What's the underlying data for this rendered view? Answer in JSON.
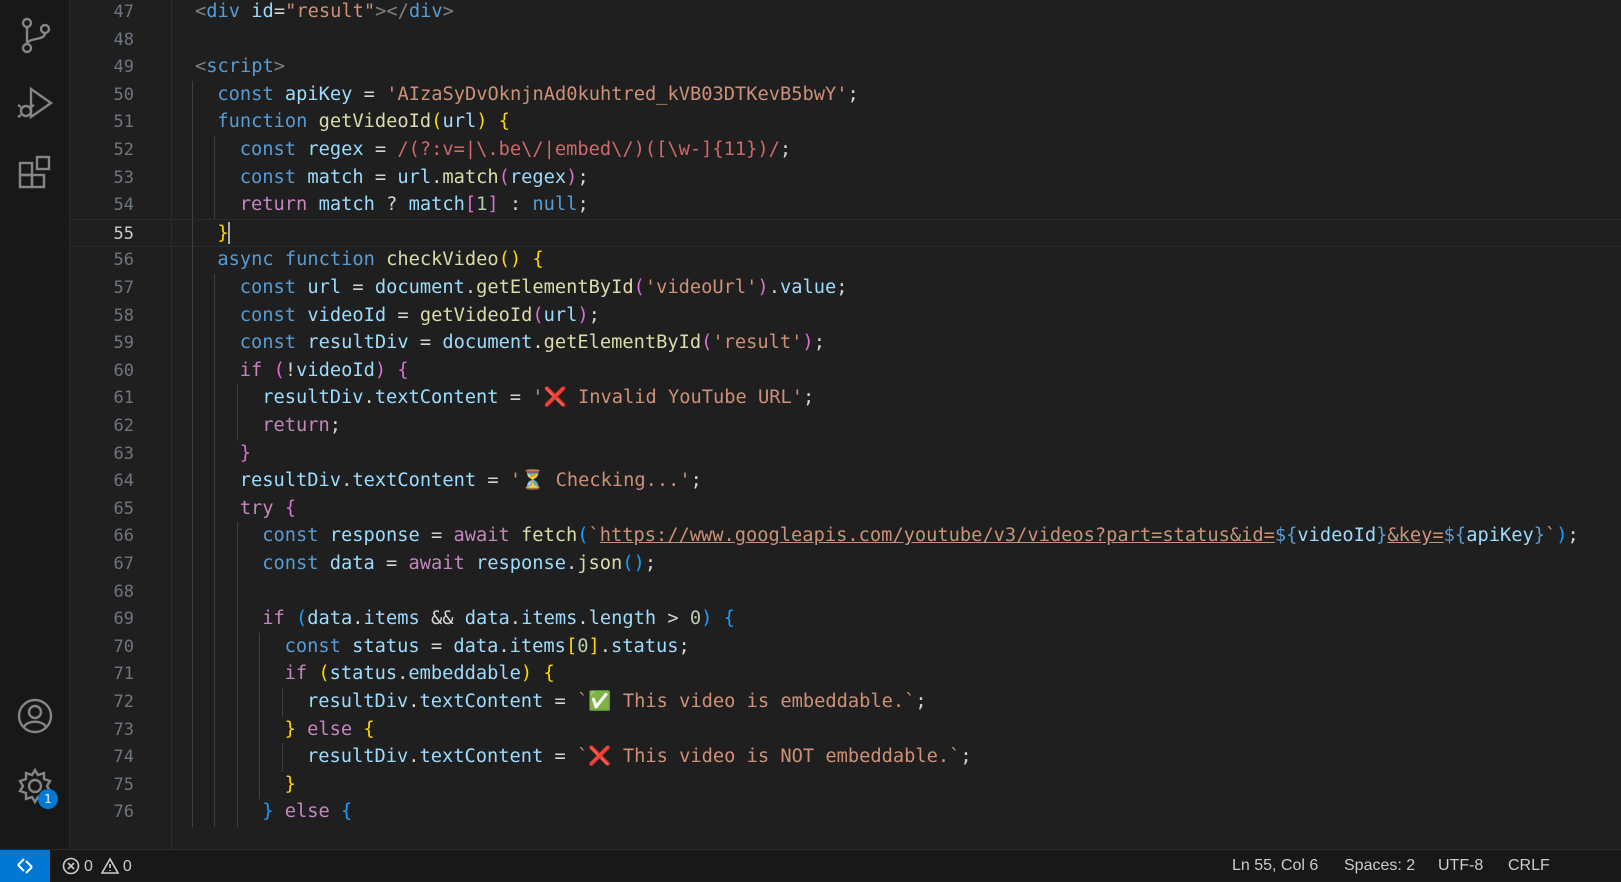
{
  "activity_bar": {
    "top_icons": [
      "source-control-icon",
      "run-debug-icon",
      "extensions-icon"
    ],
    "bottom_icons": [
      "account-icon",
      "manage-gear-icon"
    ],
    "settings_badge": "1"
  },
  "editor": {
    "current_line": 55,
    "lines": [
      {
        "n": "47",
        "tokens": [
          [
            "t-tag",
            "<"
          ],
          [
            "t-tn",
            "div"
          ],
          [
            "t-op",
            " "
          ],
          [
            "t-attr",
            "id"
          ],
          [
            "t-op",
            "="
          ],
          [
            "t-str",
            "\"result\""
          ],
          [
            "t-tag",
            "></"
          ],
          [
            "t-tn",
            "div"
          ],
          [
            "t-tag",
            ">"
          ]
        ],
        "indent": 1
      },
      {
        "n": "48",
        "tokens": [],
        "indent": 0
      },
      {
        "n": "49",
        "tokens": [
          [
            "t-tag",
            "<"
          ],
          [
            "t-tn",
            "script"
          ],
          [
            "t-tag",
            ">"
          ]
        ],
        "indent": 1
      },
      {
        "n": "50",
        "tokens": [
          [
            "t-kw",
            "const "
          ],
          [
            "t-var",
            "apiKey"
          ],
          [
            "t-op",
            " = "
          ],
          [
            "t-str",
            "'AIzaSyDvOknjnAd0kuhtred_kVB03DTKevB5bwY'"
          ],
          [
            "t-op",
            ";"
          ]
        ],
        "indent": 2
      },
      {
        "n": "51",
        "tokens": [
          [
            "t-kw",
            "function "
          ],
          [
            "t-fn",
            "getVideoId"
          ],
          [
            "t-b1",
            "("
          ],
          [
            "t-var",
            "url"
          ],
          [
            "t-b1",
            ")"
          ],
          [
            "t-op",
            " "
          ],
          [
            "t-b1",
            "{"
          ]
        ],
        "indent": 2
      },
      {
        "n": "52",
        "tokens": [
          [
            "t-kw",
            "const "
          ],
          [
            "t-var",
            "regex"
          ],
          [
            "t-op",
            " = "
          ],
          [
            "t-rx",
            "/(?:v=|\\.be\\/|embed\\/)([\\w-]{11})/"
          ],
          [
            "t-op",
            ";"
          ]
        ],
        "indent": 3
      },
      {
        "n": "53",
        "tokens": [
          [
            "t-kw",
            "const "
          ],
          [
            "t-var",
            "match"
          ],
          [
            "t-op",
            " = "
          ],
          [
            "t-var",
            "url"
          ],
          [
            "t-op",
            "."
          ],
          [
            "t-fn",
            "match"
          ],
          [
            "t-b2",
            "("
          ],
          [
            "t-var",
            "regex"
          ],
          [
            "t-b2",
            ")"
          ],
          [
            "t-op",
            ";"
          ]
        ],
        "indent": 3
      },
      {
        "n": "54",
        "tokens": [
          [
            "t-ctl",
            "return "
          ],
          [
            "t-var",
            "match"
          ],
          [
            "t-op",
            " ? "
          ],
          [
            "t-var",
            "match"
          ],
          [
            "t-b2",
            "["
          ],
          [
            "t-num",
            "1"
          ],
          [
            "t-b2",
            "]"
          ],
          [
            "t-op",
            " : "
          ],
          [
            "t-kw",
            "null"
          ],
          [
            "t-op",
            ";"
          ]
        ],
        "indent": 3
      },
      {
        "n": "55",
        "tokens": [
          [
            "t-b1",
            "}"
          ]
        ],
        "indent": 2,
        "cursor": true
      },
      {
        "n": "56",
        "tokens": [
          [
            "t-kw",
            "async "
          ],
          [
            "t-kw",
            "function "
          ],
          [
            "t-fn",
            "checkVideo"
          ],
          [
            "t-b1",
            "()"
          ],
          [
            "t-op",
            " "
          ],
          [
            "t-b1",
            "{"
          ]
        ],
        "indent": 2
      },
      {
        "n": "57",
        "tokens": [
          [
            "t-kw",
            "const "
          ],
          [
            "t-var",
            "url"
          ],
          [
            "t-op",
            " = "
          ],
          [
            "t-var",
            "document"
          ],
          [
            "t-op",
            "."
          ],
          [
            "t-fn",
            "getElementById"
          ],
          [
            "t-b2",
            "("
          ],
          [
            "t-str",
            "'videoUrl'"
          ],
          [
            "t-b2",
            ")"
          ],
          [
            "t-op",
            "."
          ],
          [
            "t-var",
            "value"
          ],
          [
            "t-op",
            ";"
          ]
        ],
        "indent": 3
      },
      {
        "n": "58",
        "tokens": [
          [
            "t-kw",
            "const "
          ],
          [
            "t-var",
            "videoId"
          ],
          [
            "t-op",
            " = "
          ],
          [
            "t-fn",
            "getVideoId"
          ],
          [
            "t-b2",
            "("
          ],
          [
            "t-var",
            "url"
          ],
          [
            "t-b2",
            ")"
          ],
          [
            "t-op",
            ";"
          ]
        ],
        "indent": 3
      },
      {
        "n": "59",
        "tokens": [
          [
            "t-kw",
            "const "
          ],
          [
            "t-var",
            "resultDiv"
          ],
          [
            "t-op",
            " = "
          ],
          [
            "t-var",
            "document"
          ],
          [
            "t-op",
            "."
          ],
          [
            "t-fn",
            "getElementById"
          ],
          [
            "t-b2",
            "("
          ],
          [
            "t-str",
            "'result'"
          ],
          [
            "t-b2",
            ")"
          ],
          [
            "t-op",
            ";"
          ]
        ],
        "indent": 3
      },
      {
        "n": "60",
        "tokens": [
          [
            "t-ctl",
            "if "
          ],
          [
            "t-b2",
            "("
          ],
          [
            "t-op",
            "!"
          ],
          [
            "t-var",
            "videoId"
          ],
          [
            "t-b2",
            ")"
          ],
          [
            "t-op",
            " "
          ],
          [
            "t-b2",
            "{"
          ]
        ],
        "indent": 3
      },
      {
        "n": "61",
        "tokens": [
          [
            "t-var",
            "resultDiv"
          ],
          [
            "t-op",
            "."
          ],
          [
            "t-var",
            "textContent"
          ],
          [
            "t-op",
            " = "
          ],
          [
            "t-str",
            "'❌ Invalid YouTube URL'"
          ],
          [
            "t-op",
            ";"
          ]
        ],
        "indent": 4
      },
      {
        "n": "62",
        "tokens": [
          [
            "t-ctl",
            "return"
          ],
          [
            "t-op",
            ";"
          ]
        ],
        "indent": 4
      },
      {
        "n": "63",
        "tokens": [
          [
            "t-b2",
            "}"
          ]
        ],
        "indent": 3
      },
      {
        "n": "64",
        "tokens": [
          [
            "t-var",
            "resultDiv"
          ],
          [
            "t-op",
            "."
          ],
          [
            "t-var",
            "textContent"
          ],
          [
            "t-op",
            " = "
          ],
          [
            "t-str",
            "'⏳ Checking...'"
          ],
          [
            "t-op",
            ";"
          ]
        ],
        "indent": 3
      },
      {
        "n": "65",
        "tokens": [
          [
            "t-ctl",
            "try "
          ],
          [
            "t-b2",
            "{"
          ]
        ],
        "indent": 3
      },
      {
        "n": "66",
        "tokens": [
          [
            "t-kw",
            "const "
          ],
          [
            "t-var",
            "response"
          ],
          [
            "t-op",
            " = "
          ],
          [
            "t-ctl",
            "await "
          ],
          [
            "t-fn",
            "fetch"
          ],
          [
            "t-b3",
            "("
          ],
          [
            "t-str",
            "`"
          ],
          [
            "t-url",
            "https://www.googleapis.com/youtube/v3/videos?part=status&id="
          ],
          [
            "t-tpl",
            "${"
          ],
          [
            "t-var",
            "videoId"
          ],
          [
            "t-tpl",
            "}"
          ],
          [
            "t-url",
            "&key="
          ],
          [
            "t-tpl",
            "${"
          ],
          [
            "t-var",
            "apiKey"
          ],
          [
            "t-tpl",
            "}"
          ],
          [
            "t-str",
            "`"
          ],
          [
            "t-b3",
            ")"
          ],
          [
            "t-op",
            ";"
          ]
        ],
        "indent": 4
      },
      {
        "n": "67",
        "tokens": [
          [
            "t-kw",
            "const "
          ],
          [
            "t-var",
            "data"
          ],
          [
            "t-op",
            " = "
          ],
          [
            "t-ctl",
            "await "
          ],
          [
            "t-var",
            "response"
          ],
          [
            "t-op",
            "."
          ],
          [
            "t-fn",
            "json"
          ],
          [
            "t-b3",
            "()"
          ],
          [
            "t-op",
            ";"
          ]
        ],
        "indent": 4
      },
      {
        "n": "68",
        "tokens": [],
        "indent": 4
      },
      {
        "n": "69",
        "tokens": [
          [
            "t-ctl",
            "if "
          ],
          [
            "t-b3",
            "("
          ],
          [
            "t-var",
            "data"
          ],
          [
            "t-op",
            "."
          ],
          [
            "t-var",
            "items"
          ],
          [
            "t-op",
            " && "
          ],
          [
            "t-var",
            "data"
          ],
          [
            "t-op",
            "."
          ],
          [
            "t-var",
            "items"
          ],
          [
            "t-op",
            "."
          ],
          [
            "t-var",
            "length"
          ],
          [
            "t-op",
            " > "
          ],
          [
            "t-num",
            "0"
          ],
          [
            "t-b3",
            ")"
          ],
          [
            "t-op",
            " "
          ],
          [
            "t-b3",
            "{"
          ]
        ],
        "indent": 4
      },
      {
        "n": "70",
        "tokens": [
          [
            "t-kw",
            "const "
          ],
          [
            "t-var",
            "status"
          ],
          [
            "t-op",
            " = "
          ],
          [
            "t-var",
            "data"
          ],
          [
            "t-op",
            "."
          ],
          [
            "t-var",
            "items"
          ],
          [
            "t-b1",
            "["
          ],
          [
            "t-num",
            "0"
          ],
          [
            "t-b1",
            "]"
          ],
          [
            "t-op",
            "."
          ],
          [
            "t-var",
            "status"
          ],
          [
            "t-op",
            ";"
          ]
        ],
        "indent": 5
      },
      {
        "n": "71",
        "tokens": [
          [
            "t-ctl",
            "if "
          ],
          [
            "t-b1",
            "("
          ],
          [
            "t-var",
            "status"
          ],
          [
            "t-op",
            "."
          ],
          [
            "t-var",
            "embeddable"
          ],
          [
            "t-b1",
            ")"
          ],
          [
            "t-op",
            " "
          ],
          [
            "t-b1",
            "{"
          ]
        ],
        "indent": 5
      },
      {
        "n": "72",
        "tokens": [
          [
            "t-var",
            "resultDiv"
          ],
          [
            "t-op",
            "."
          ],
          [
            "t-var",
            "textContent"
          ],
          [
            "t-op",
            " = "
          ],
          [
            "t-str",
            "`✅ This video is embeddable.`"
          ],
          [
            "t-op",
            ";"
          ]
        ],
        "indent": 6
      },
      {
        "n": "73",
        "tokens": [
          [
            "t-b1",
            "}"
          ],
          [
            "t-op",
            " "
          ],
          [
            "t-ctl",
            "else "
          ],
          [
            "t-b1",
            "{"
          ]
        ],
        "indent": 5
      },
      {
        "n": "74",
        "tokens": [
          [
            "t-var",
            "resultDiv"
          ],
          [
            "t-op",
            "."
          ],
          [
            "t-var",
            "textContent"
          ],
          [
            "t-op",
            " = "
          ],
          [
            "t-str",
            "`❌ This video is NOT embeddable.`"
          ],
          [
            "t-op",
            ";"
          ]
        ],
        "indent": 6
      },
      {
        "n": "75",
        "tokens": [
          [
            "t-b1",
            "}"
          ]
        ],
        "indent": 5
      },
      {
        "n": "76",
        "tokens": [
          [
            "t-b3",
            "}"
          ],
          [
            "t-op",
            " "
          ],
          [
            "t-ctl",
            "else "
          ],
          [
            "t-b3",
            "{"
          ]
        ],
        "indent": 4
      }
    ]
  },
  "status_bar": {
    "errors": "0",
    "warnings": "0",
    "position": "Ln 55, Col 6",
    "spaces": "Spaces: 2",
    "encoding": "UTF-8",
    "eol": "CRLF"
  }
}
